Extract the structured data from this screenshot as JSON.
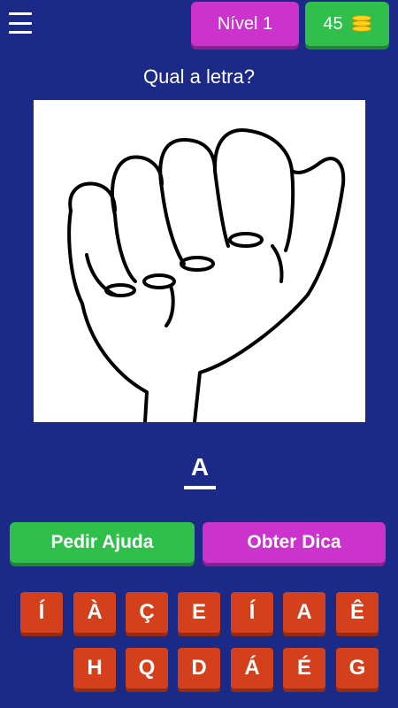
{
  "header": {
    "menu_icon": "hamburger-menu-icon",
    "level_label": "Nível 1",
    "coins": "45",
    "coin_icon": "coin-stack-icon"
  },
  "question": "Qual a letra?",
  "image": {
    "icon": "sign-language-fist-letter-a"
  },
  "answer": {
    "slots": [
      "A"
    ]
  },
  "actions": {
    "help_label": "Pedir Ajuda",
    "hint_label": "Obter Dica"
  },
  "keyboard": {
    "row1": [
      "Í",
      "À",
      "Ç",
      "E",
      "Í",
      "A",
      "Ê"
    ],
    "row2": [
      "H",
      "Q",
      "D",
      "Á",
      "É",
      "G"
    ]
  },
  "colors": {
    "background": "#1b2a86",
    "green": "#2fbf4a",
    "magenta": "#cc33cc",
    "key_orange": "#d4401c"
  }
}
